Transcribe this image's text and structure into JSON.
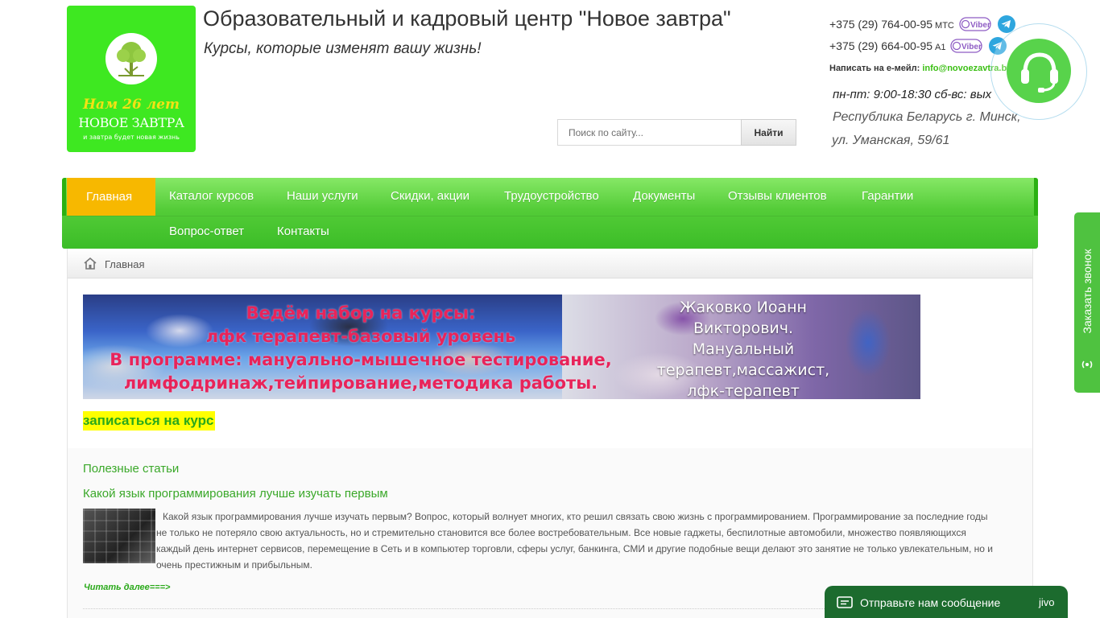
{
  "header": {
    "logo": {
      "years": "Нам 26 лет",
      "brand": "НОВОЕ ЗАВТРА",
      "tagline": "и завтра будет новая жизнь"
    },
    "title": "Образовательный и кадровый центр \"Новое завтра\"",
    "slogan": "Курсы, которые изменят вашу жизнь!",
    "search": {
      "placeholder": "Поиск по сайту...",
      "button_label": "Найти"
    },
    "contacts": {
      "phone1": "+375 (29) 764-00-95",
      "phone1_operator": "МТС",
      "phone2": "+375 (29) 664-00-95",
      "phone2_operator": "А1",
      "viber_label": "Viber",
      "email_label": "Написать на е-мейл:",
      "email": "info@novoezavtra.by",
      "hours": "пн-пт: 9:00-18:30 сб-вс: вых",
      "address_line1": "Республика Беларусь г. Минск,",
      "address_line2": "ул. Уманская, 59/61"
    }
  },
  "menu": {
    "items": [
      {
        "label": "Главная",
        "active": true
      },
      {
        "label": "Каталог курсов"
      },
      {
        "label": "Наши услуги"
      },
      {
        "label": "Скидки, акции"
      },
      {
        "label": "Трудоустройство"
      },
      {
        "label": "Документы"
      },
      {
        "label": "Отзывы клиентов"
      },
      {
        "label": "Гарантии"
      },
      {
        "label": "Вопрос-ответ"
      },
      {
        "label": "Контакты"
      }
    ]
  },
  "breadcrumb": {
    "home_label": "Главная"
  },
  "banner": {
    "promo_line1": "Ведём набор на курсы:",
    "promo_line2": "лфк терапевт-базовый уровень",
    "promo_line3": "В программе: мануально-мышечное тестирование,",
    "promo_line4": "лимфодринаж,тейпирование,методика работы.",
    "trainer_line1": "Жаковко Иоанн",
    "trainer_line2": "Викторович.",
    "trainer_line3": "Мануальный",
    "trainer_line4": "терапевт,массажист,",
    "trainer_line5": "лфк-терапевт"
  },
  "signup_label": "записаться на курс",
  "articles": {
    "section_title": "Полезные статьи",
    "items": [
      {
        "title": "Какой язык программирования лучше изучать первым",
        "text": "Какой язык программирования лучше изучать первым? Вопрос, который волнует многих,   кто решил связать свою жизнь с программированием. Программирование за последние    годы не только не потеряло свою актуальность, но и стремительно становится все более   востребовательным. Все новые гаджеты, беспилотные автомобили, множество   появляющихся каждый день интернет сервисов, перемещение в Сеть и в компьютер торговли, сферы услуг, банкинга, СМИ и другие подобные вещи делают это занятие не только увлекательным, но и очень престижным и прибыльным.",
        "read_more": "Читать далее===>"
      }
    ]
  },
  "widgets": {
    "callback_label": "Заказать звонок",
    "chat_label": "Отправьте нам сообщение",
    "chat_brand": "jivo"
  },
  "colors": {
    "brand_green": "#3ee821",
    "menu_green": "#54cc38",
    "menu_active": "#f7b800",
    "link_green": "#3aa829",
    "promo_pink": "#e8245a",
    "chat_bar": "#1c6b2e"
  }
}
